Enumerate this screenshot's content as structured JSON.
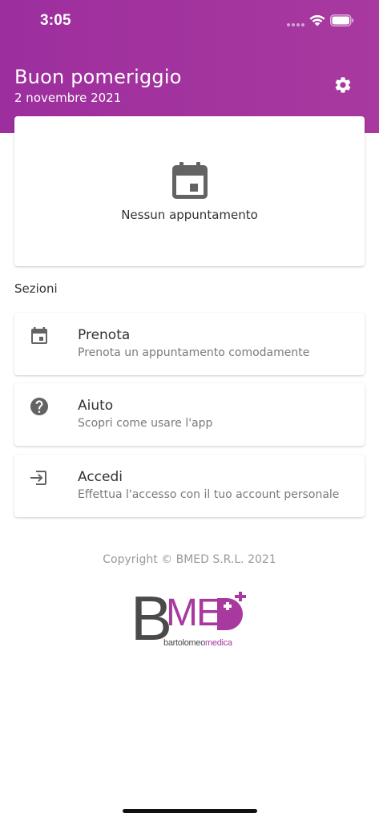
{
  "status_bar": {
    "time": "3:05"
  },
  "header": {
    "greeting": "Buon pomeriggio",
    "date": "2 novembre 2021",
    "settings_icon": "gear-icon",
    "background_color": "#a2329e"
  },
  "appointments": {
    "icon": "calendar-icon",
    "empty_text": "Nessun appuntamento"
  },
  "sections": {
    "title": "Sezioni",
    "items": [
      {
        "icon": "calendar-icon",
        "title": "Prenota",
        "subtitle": "Prenota un appuntamento comodamente"
      },
      {
        "icon": "help-icon",
        "title": "Aiuto",
        "subtitle": "Scopri come usare l'app"
      },
      {
        "icon": "login-icon",
        "title": "Accedi",
        "subtitle": "Effettua l'accesso con il tuo account personale"
      }
    ]
  },
  "footer": {
    "copyright": "Copyright © BMED S.R.L. 2021",
    "logo": {
      "letter_b": "B",
      "letters_me": "ME",
      "letter_d": "D",
      "sub_grey": "bartolomeo",
      "sub_purple": "medica",
      "brand_purple": "#a8399f",
      "brand_grey": "#4a4a4a"
    }
  },
  "colors": {
    "accent": "#a2329e",
    "text_primary": "#333333",
    "text_secondary": "#7a7a7a",
    "icon_grey": "#636363"
  }
}
